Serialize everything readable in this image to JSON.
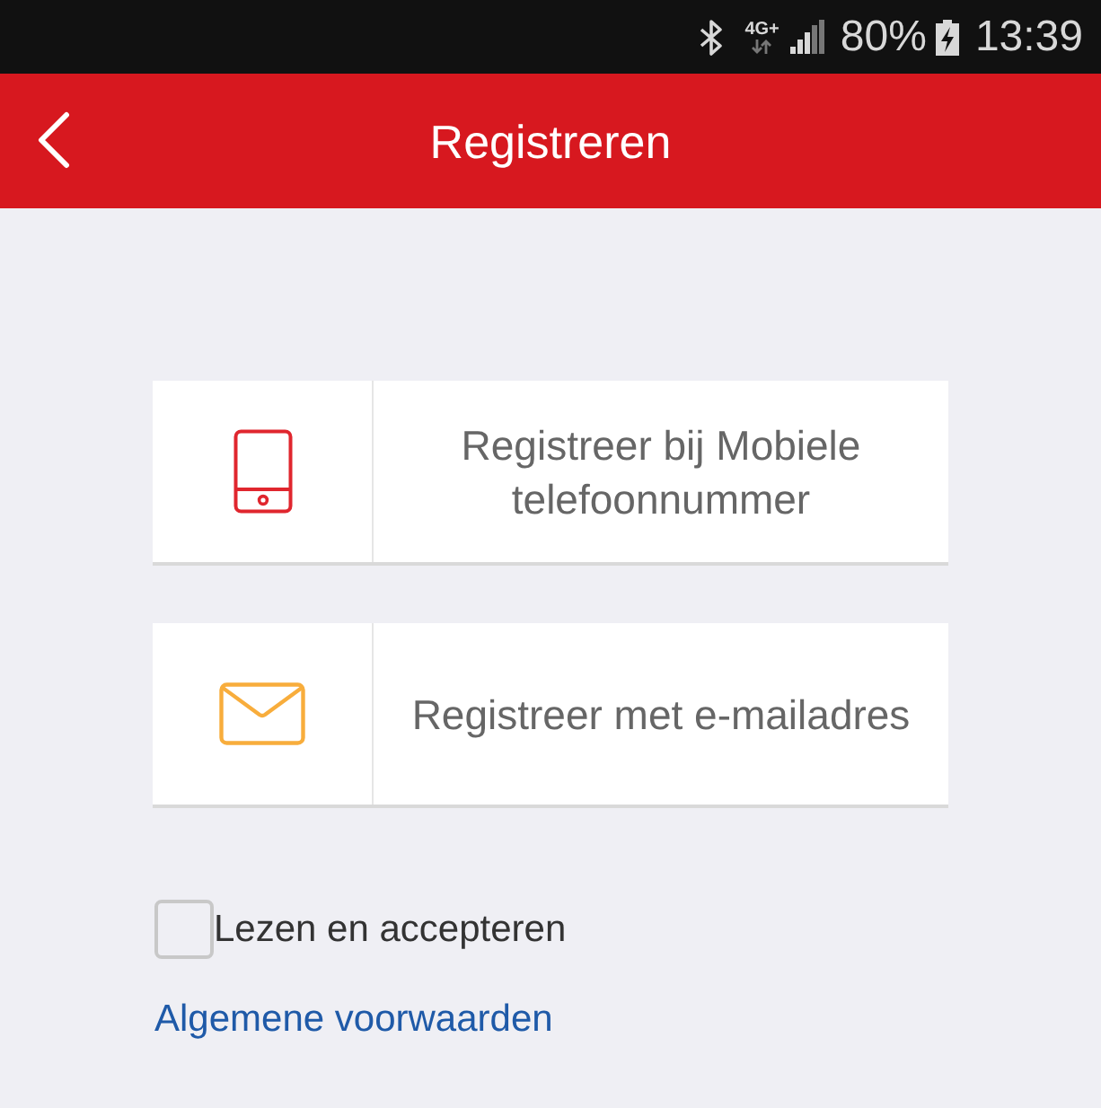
{
  "status_bar": {
    "network": "4G+",
    "battery": "80%",
    "time": "13:39"
  },
  "header": {
    "title": "Registreren"
  },
  "options": [
    {
      "kind": "phone",
      "label": "Registreer bij Mobiele telefoonnummer"
    },
    {
      "kind": "email",
      "label": "Registreer met e-mailadres"
    }
  ],
  "agreement": {
    "checked": false,
    "label": "Lezen en accepteren",
    "link": "Algemene voorwaarden"
  }
}
